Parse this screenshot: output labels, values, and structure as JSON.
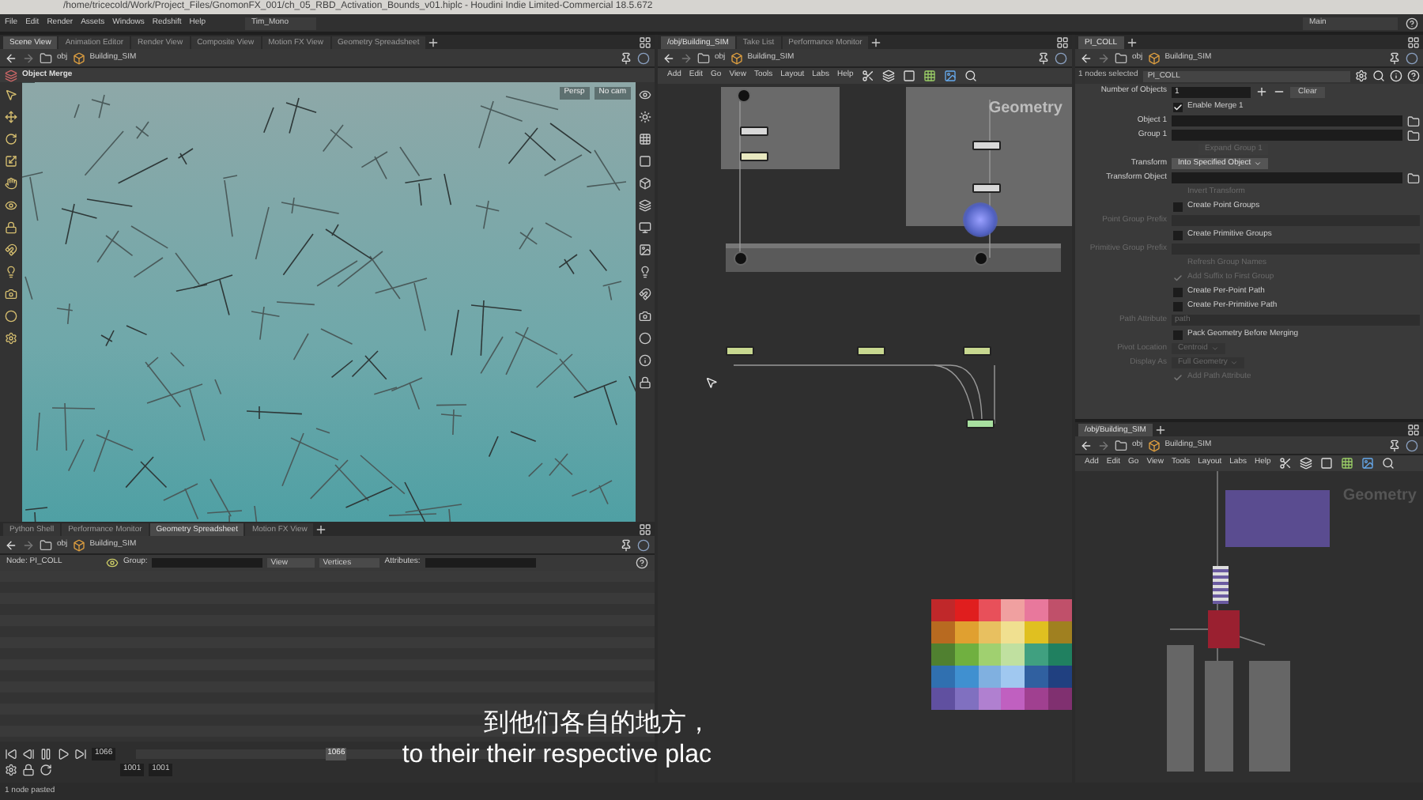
{
  "title_bar": {
    "title": "/home/tricecold/Work/Project_Files/GnomonFX_001/ch_05_RBD_Activation_Bounds_v01.hiplc - Houdini Indie Limited-Commercial 18.5.672"
  },
  "menu_bar": {
    "items": [
      "File",
      "Edit",
      "Render",
      "Assets",
      "Windows",
      "Redshift",
      "Help"
    ],
    "desktop": "Tim_Mono",
    "desktop_right": "Main"
  },
  "scene_pane": {
    "tabs": [
      {
        "label": "Scene View",
        "selected": true
      },
      {
        "label": "Animation Editor",
        "selected": false
      },
      {
        "label": "Render View",
        "selected": false
      },
      {
        "label": "Composite View",
        "selected": false
      },
      {
        "label": "Motion FX View",
        "selected": false
      },
      {
        "label": "Geometry Spreadsheet",
        "selected": false
      }
    ],
    "path": [
      "obj",
      "Building_SIM"
    ],
    "operator": "Object Merge",
    "viewport_badges": [
      "Persp",
      "No cam"
    ]
  },
  "spreadsheet_pane": {
    "tabs": [
      {
        "label": "Python Shell",
        "selected": false
      },
      {
        "label": "Performance Monitor",
        "selected": false
      },
      {
        "label": "Geometry Spreadsheet",
        "selected": true
      },
      {
        "label": "Motion FX View",
        "selected": false
      }
    ],
    "path": [
      "obj",
      "Building_SIM"
    ],
    "node": "Node: PI_COLL",
    "group_label": "Group:",
    "view": "View",
    "class": "Vertices",
    "attributes_label": "Attributes:"
  },
  "timeline": {
    "frame": "1066",
    "start": "1001",
    "end": "1001",
    "marker": "1066"
  },
  "network_pane": {
    "tabs": [
      {
        "label": "/obj/Building_SIM",
        "selected": true
      },
      {
        "label": "Take List",
        "selected": false
      },
      {
        "label": "Performance Monitor",
        "selected": false
      }
    ],
    "path": [
      "obj",
      "Building_SIM"
    ],
    "menu": [
      "Add",
      "Edit",
      "Go",
      "View",
      "Tools",
      "Layout",
      "Labs",
      "Help"
    ],
    "context": "Geometry",
    "palette": [
      {
        "color": "#c0282a"
      },
      {
        "color": "#e01e1e"
      },
      {
        "color": "#e8505a"
      },
      {
        "color": "#f0a0a0"
      },
      {
        "color": "#e8789c"
      },
      {
        "color": "#c0506a"
      },
      {
        "color": "#b86a20"
      },
      {
        "color": "#e0a030"
      },
      {
        "color": "#e8c060"
      },
      {
        "color": "#f0e090"
      },
      {
        "color": "#e0c020"
      },
      {
        "color": "#a08020"
      },
      {
        "color": "#508030"
      },
      {
        "color": "#70b040"
      },
      {
        "color": "#a0d070"
      },
      {
        "color": "#c0e0a0"
      },
      {
        "color": "#40a080"
      },
      {
        "color": "#208060"
      },
      {
        "color": "#3070b0"
      },
      {
        "color": "#4090d0"
      },
      {
        "color": "#80b0e0"
      },
      {
        "color": "#a0c8f0"
      },
      {
        "color": "#3060a0"
      },
      {
        "color": "#204080"
      },
      {
        "color": "#6050a0"
      },
      {
        "color": "#8070c0"
      },
      {
        "color": "#b080d0"
      },
      {
        "color": "#c060c0"
      },
      {
        "color": "#a04090"
      },
      {
        "color": "#803070"
      }
    ]
  },
  "parameter_pane": {
    "tabs": [
      {
        "label": "PI_COLL",
        "selected": true
      }
    ],
    "path": [
      "obj",
      "Building_SIM"
    ],
    "selection": "1 nodes selected",
    "node_name": "PI_COLL",
    "count_label": "Number of Objects",
    "count": "1",
    "clear": "Clear",
    "params": [
      {
        "kind": "checkbox",
        "label": "Enable Merge 1",
        "checked": true,
        "disabled": false
      },
      {
        "kind": "field",
        "label": "Object 1",
        "disabled": false
      },
      {
        "kind": "field",
        "label": "Group 1",
        "disabled": false
      },
      {
        "kind": "button",
        "label": "Expand Group 1",
        "disabled": true
      },
      {
        "kind": "dropdown",
        "label": "Transform",
        "value": "Into Specified Object",
        "disabled": false
      },
      {
        "kind": "field",
        "label": "Transform Object",
        "disabled": false
      },
      {
        "kind": "checkbox",
        "label": "Invert Transform",
        "checked": false,
        "disabled": true
      },
      {
        "kind": "checkbox",
        "label": "Create Point Groups",
        "checked": false,
        "disabled": false
      },
      {
        "kind": "field",
        "label": "Point Group Prefix",
        "disabled": true
      },
      {
        "kind": "checkbox",
        "label": "Create Primitive Groups",
        "checked": false,
        "disabled": false
      },
      {
        "kind": "field",
        "label": "Primitive Group Prefix",
        "disabled": true
      },
      {
        "kind": "checkbox",
        "label": "Refresh Group Names",
        "checked": false,
        "disabled": true
      },
      {
        "kind": "checkbox",
        "label": "Add Suffix to First Group",
        "checked": true,
        "disabled": true
      },
      {
        "kind": "checkbox",
        "label": "Create Per-Point Path",
        "checked": false,
        "disabled": false
      },
      {
        "kind": "checkbox",
        "label": "Create Per-Primitive Path",
        "checked": false,
        "disabled": false
      },
      {
        "kind": "field",
        "label": "Path Attribute",
        "value": "path",
        "disabled": true
      },
      {
        "kind": "checkbox",
        "label": "Pack Geometry Before Merging",
        "checked": false,
        "disabled": false
      },
      {
        "kind": "dropdown",
        "label": "Pivot Location",
        "value": "Centroid",
        "disabled": true
      },
      {
        "kind": "dropdown",
        "label": "Display As",
        "value": "Full Geometry",
        "disabled": true
      },
      {
        "kind": "checkbox",
        "label": "Add Path Attribute",
        "checked": true,
        "disabled": true
      }
    ]
  },
  "network_pane_2": {
    "tabs": [
      {
        "label": "/obj/Building_SIM",
        "selected": true
      }
    ],
    "path": [
      "obj",
      "Building_SIM"
    ],
    "menu": [
      "Add",
      "Edit",
      "Go",
      "View",
      "Tools",
      "Layout",
      "Labs",
      "Help"
    ],
    "context": "Geometry"
  },
  "subtitles": [
    "到他们各自的地方，",
    "to their their respective plac"
  ],
  "status_bar": {
    "message": "1 node pasted"
  }
}
